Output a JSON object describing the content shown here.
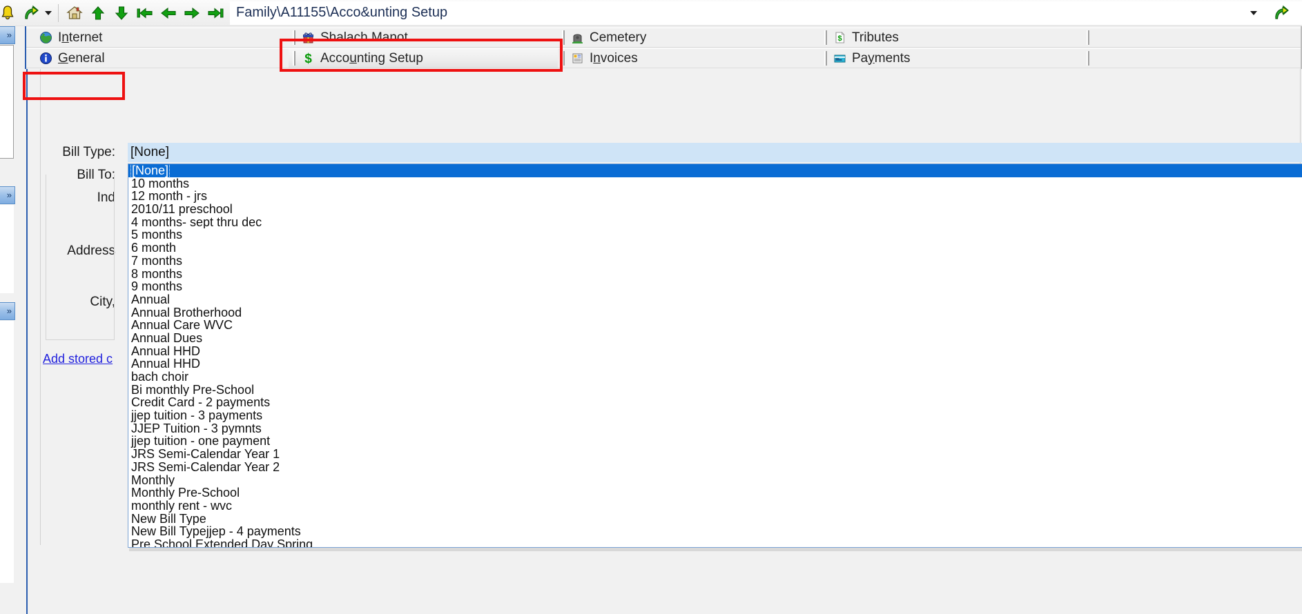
{
  "toolbar": {
    "icons": [
      {
        "name": "bell-icon",
        "label": "Alerts"
      },
      {
        "name": "redo-arrow-icon",
        "label": "Redo"
      },
      {
        "name": "dropdown-caret-icon",
        "label": "More"
      },
      {
        "name": "home-icon",
        "label": "Home"
      },
      {
        "name": "arrow-up-icon",
        "label": "Up"
      },
      {
        "name": "arrow-down-icon",
        "label": "Down"
      },
      {
        "name": "first-record-icon",
        "label": "First"
      },
      {
        "name": "previous-record-icon",
        "label": "Previous"
      },
      {
        "name": "next-record-icon",
        "label": "Next"
      },
      {
        "name": "last-record-icon",
        "label": "Last"
      }
    ],
    "address": {
      "value": "Family\\A11155\\Acco&unting Setup",
      "dropdown_caret": "▼",
      "go_label": "Go"
    }
  },
  "tabs": {
    "column1": [
      {
        "label_pre": "I",
        "label_key": "n",
        "label_post": "ternet",
        "icon": "globe-icon",
        "name": "tab-internet"
      },
      {
        "label_pre": "",
        "label_key": "G",
        "label_post": "eneral",
        "icon": "info-icon",
        "name": "tab-general"
      }
    ],
    "column2": [
      {
        "label_pre": "Shalach Manot",
        "label_key": "",
        "label_post": "",
        "icon": "gift-icon",
        "name": "tab-shalach-manot"
      },
      {
        "label_pre": "Acco",
        "label_key": "u",
        "label_post": "nting Setup",
        "icon": "dollar-icon",
        "name": "tab-accounting-setup"
      }
    ],
    "column3": [
      {
        "label_pre": "Cemetery",
        "label_key": "",
        "label_post": "",
        "icon": "cemetery-icon",
        "name": "tab-cemetery"
      },
      {
        "label_pre": "I",
        "label_key": "n",
        "label_post": "voices",
        "icon": "invoice-icon",
        "name": "tab-invoices"
      }
    ],
    "column4": [
      {
        "label_pre": "Tributes",
        "label_key": "",
        "label_post": "",
        "icon": "tribute-doc-icon",
        "name": "tab-tributes"
      },
      {
        "label_pre": "Pa",
        "label_key": "y",
        "label_post": "ments",
        "icon": "payment-card-icon",
        "name": "tab-payments"
      }
    ]
  },
  "form": {
    "bill_type_label": "Bill Type:",
    "bill_to_label": "Bill To:",
    "individual_label": "Ind",
    "address_label": "Address",
    "city_label": "City, ",
    "add_stored_link": "Add stored c"
  },
  "combo": {
    "name": "bill-type-combo",
    "selected_value": "[None]",
    "expanded": true,
    "options": [
      "[None]",
      "10 months",
      "12 month - jrs",
      "2010/11 preschool",
      "4 months- sept thru dec",
      "5 months",
      "6 month",
      "7 months",
      "8 months",
      "9 months",
      "Annual",
      "Annual Brotherhood",
      "Annual Care WVC",
      "Annual Dues",
      "Annual HHD",
      "Annual HHD",
      "bach choir",
      "Bi monthly Pre-School",
      "Credit Card - 2 payments",
      "jjep tuition - 3 payments",
      "JJEP Tuition - 3 pymnts",
      "jjep tuition - one payment",
      "JRS Semi-Calendar Year 1",
      "JRS Semi-Calendar Year 2",
      "Monthly",
      "Monthly Pre-School",
      "monthly rent - wvc",
      "New Bill Type",
      "New Bill Typejjep - 4 payments",
      "Pre School Extended Day Spring"
    ],
    "selected_index": 0
  },
  "annotations": {
    "highlight_boxes": [
      {
        "name": "accounting-setup-tab-highlight",
        "color": "#ee1111"
      },
      {
        "name": "bill-type-label-highlight",
        "color": "#ee1111"
      }
    ]
  },
  "colors": {
    "accent_blue": "#2a5db0",
    "selection_blue": "#0a6cd4",
    "combo_fill": "#cfe4f7",
    "annotation_red": "#ee1111",
    "link_blue": "#2222dd",
    "icon_green": "#009900"
  }
}
